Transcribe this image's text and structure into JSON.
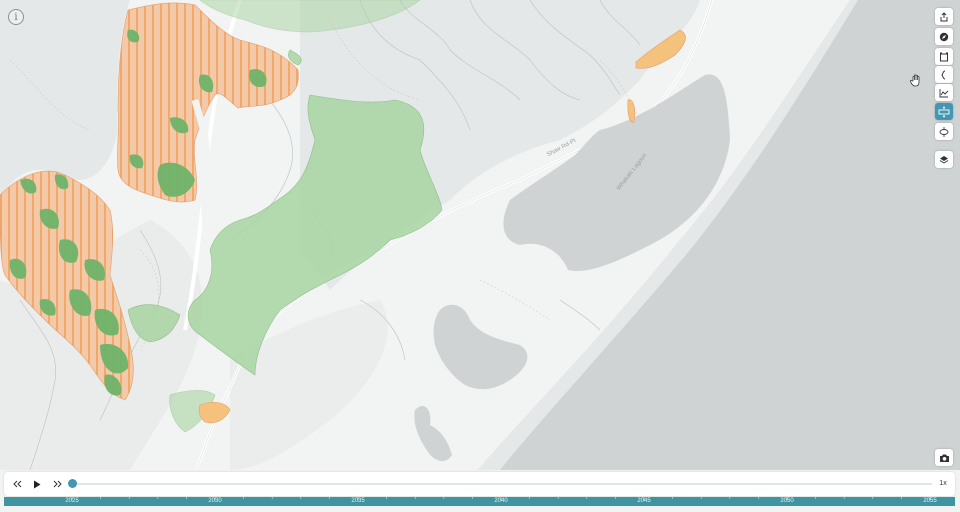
{
  "map": {
    "labels": {
      "road": "Shaw Rd-Pt",
      "lagoon": "Whakaki Lagoon"
    },
    "colors": {
      "land": "#f2f3f3",
      "sea": "#cfd3d4",
      "beach": "#e9ebeb",
      "lagoon": "#cfd3d4",
      "forest": "#a8d4a2",
      "forest_dark": "#6fb36a",
      "harvest_orange": "#f4c27d",
      "harvest_pink": "#f2b8a8",
      "accent": "#4397b1"
    }
  },
  "info_button": {
    "icon": "info-icon",
    "glyph": "i"
  },
  "toolbar": {
    "items": [
      {
        "name": "share-button",
        "icon": "share-icon"
      },
      {
        "name": "compass-button",
        "icon": "compass-icon"
      },
      {
        "name": "frame-button",
        "icon": "frame-icon"
      },
      {
        "name": "bracket-button",
        "icon": "bracket-icon"
      },
      {
        "name": "chart-button",
        "icon": "line-chart-icon"
      },
      {
        "name": "ruler-button",
        "icon": "ruler-icon",
        "active": true
      },
      {
        "name": "rotate-button",
        "icon": "rotate-3d-icon"
      },
      {
        "name": "layers-button",
        "icon": "layers-icon"
      }
    ]
  },
  "camera_button": {
    "icon": "camera-icon"
  },
  "player": {
    "rewind_icon": "rewind-icon",
    "play_icon": "play-icon",
    "forward_icon": "fast-forward-icon",
    "speed": "1x",
    "progress": 0.0
  },
  "timeline": {
    "years": [
      "2025",
      "2030",
      "2035",
      "2040",
      "2045",
      "2050",
      "2055"
    ]
  }
}
